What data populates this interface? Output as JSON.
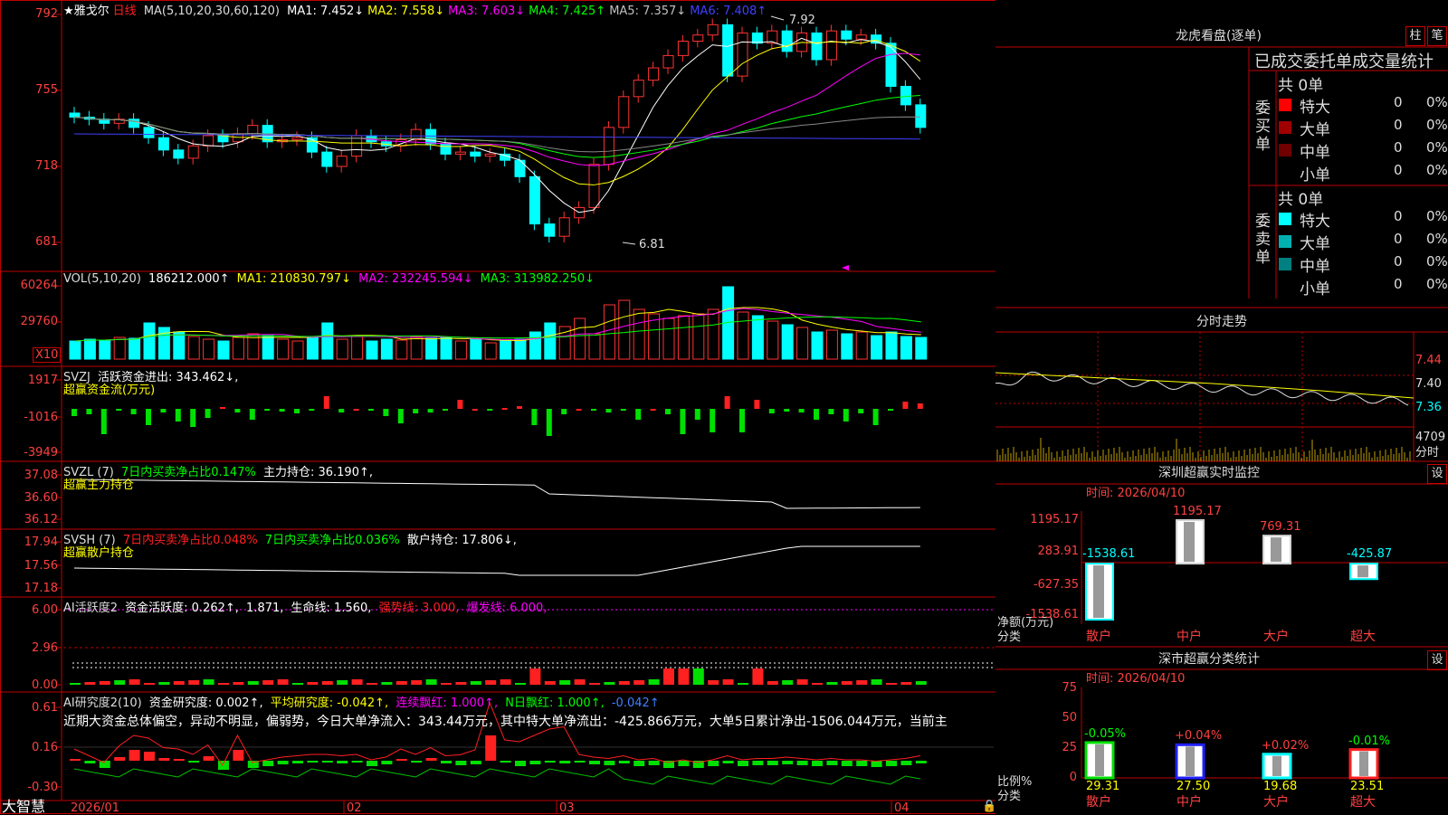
{
  "main": {
    "title": "★雅戈尔",
    "period": "日线",
    "ma_label": "MA(5,10,20,30,60,120)",
    "ma_values": [
      {
        "name": "MA1:",
        "value": "7.452↓",
        "color": "#ffffff"
      },
      {
        "name": "MA2:",
        "value": "7.558↓",
        "color": "#ffff00"
      },
      {
        "name": "MA3:",
        "value": "7.603↓",
        "color": "#ff00ff"
      },
      {
        "name": "MA4:",
        "value": "7.425↑",
        "color": "#00ff00"
      },
      {
        "name": "MA5:",
        "value": "7.357↓",
        "color": "#c0c0c0"
      },
      {
        "name": "MA6:",
        "value": "7.408↑",
        "color": "#4040ff"
      }
    ],
    "y_ticks": [
      "792",
      "755",
      "718",
      "681"
    ],
    "high_mark": "7.92",
    "low_mark": "6.81"
  },
  "vol": {
    "header": "VOL(5,10,20)",
    "value": "186212.000↑",
    "ma1": "MA1: 210830.797↓",
    "ma2": "MA2: 232245.594↓",
    "ma3": "MA3: 313982.250↓",
    "y_ticks": [
      "60264",
      "29760"
    ],
    "unit": "X10"
  },
  "svzj": {
    "header": "SVZJ",
    "line1": "活跃资金进出: 343.462↓,",
    "line2": "超赢资金流(万元)",
    "y_ticks": [
      "1917",
      "-1016",
      "-3949"
    ]
  },
  "svzl": {
    "header": "SVZL (7)",
    "part1": "7日内买卖净占比0.147%",
    "part2": "主力持仓: 36.190↑,",
    "line2": "超赢主力持仓",
    "y_ticks": [
      "37.08",
      "36.60",
      "36.12"
    ]
  },
  "svsh": {
    "header": "SVSH (7)",
    "part1": "7日内买卖净占比0.048%",
    "part2": "7日内买卖净占比0.036%",
    "part3": "散户持仓: 17.806↓,",
    "line2": "超赢散户持仓",
    "y_ticks": [
      "17.94",
      "17.56",
      "17.18"
    ]
  },
  "ai1": {
    "header": "AI活跃度2",
    "part1": "资金活跃度: 0.262↑,",
    "part2": "1.871,",
    "part3": "生命线: 1.560,",
    "part4": "强势线: 3.000,",
    "part5": "爆发线: 6.000,",
    "y_ticks": [
      "6.00",
      "2.96",
      "0.00"
    ]
  },
  "ai2": {
    "header": "AI研究度2(10)",
    "part1": "资金研究度: 0.002↑,",
    "part2": "平均研究度: -0.042↑,",
    "part3": "连续飘红: 1.000↑,",
    "part4": "N日飘红: 1.000↑,",
    "part5": "-0.042↑",
    "text": "近期大资金总体偏空，异动不明显，偏弱势，今日大单净流入：343.44万元，其中特大单净流出：-425.866万元，大单5日累计净出-1506.044万元，当前主",
    "y_ticks": [
      "0.61",
      "0.16",
      "-0.30"
    ]
  },
  "xaxis": {
    "labels": [
      "2026/01",
      "02",
      "03",
      "04"
    ],
    "brand": "大智慧"
  },
  "lhb": {
    "title": "龙虎看盘(逐单)",
    "btn1": "柱",
    "btn2": "笔",
    "subtitle": "已成交委托单成交量统计",
    "buy_label": "委买单",
    "sell_label": "委卖单",
    "buy_total": "共 0单",
    "sell_total": "共 0单",
    "buy_rows": [
      {
        "name": "特大",
        "val": "0",
        "pct": "0%",
        "color": "#ff0000"
      },
      {
        "name": "大单",
        "val": "0",
        "pct": "0%",
        "color": "#a00000"
      },
      {
        "name": "中单",
        "val": "0",
        "pct": "0%",
        "color": "#700000"
      },
      {
        "name": "小单",
        "val": "0",
        "pct": "0%",
        "color": "#000000"
      }
    ],
    "sell_rows": [
      {
        "name": "特大",
        "val": "0",
        "pct": "0%",
        "color": "#00ffff"
      },
      {
        "name": "大单",
        "val": "0",
        "pct": "0%",
        "color": "#00b0b0"
      },
      {
        "name": "中单",
        "val": "0",
        "pct": "0%",
        "color": "#008080"
      },
      {
        "name": "小单",
        "val": "0",
        "pct": "0%",
        "color": "#000000"
      }
    ]
  },
  "fenshi": {
    "title": "分时走势",
    "y_ticks": [
      "7.44",
      "7.40",
      "7.36"
    ],
    "vol_tick": "4709",
    "vol_label": "分时"
  },
  "sz_monitor": {
    "title": "深圳超赢实时监控",
    "btn": "设",
    "time": "时间: 2026/04/10",
    "y_ticks": [
      "1195.17",
      "283.91",
      "-627.35",
      "-1538.61"
    ],
    "y_label": "净额(万元)",
    "x_label": "分类",
    "categories": [
      "散户",
      "中户",
      "大户",
      "超大"
    ],
    "values": [
      -1538.61,
      1195.17,
      769.31,
      -425.87
    ],
    "value_labels": [
      "-1538.61",
      "1195.17",
      "769.31",
      "-425.87"
    ]
  },
  "sz_stats": {
    "title": "深市超赢分类统计",
    "btn": "设",
    "time": "时间: 2026/04/10",
    "y_ticks": [
      "75",
      "50",
      "25",
      "0"
    ],
    "y_label": "比例%",
    "x_label": "分类",
    "categories": [
      "散户",
      "中户",
      "大户",
      "超大"
    ],
    "values": [
      29.31,
      27.5,
      19.68,
      23.51
    ],
    "changes": [
      "-0.05%",
      "+0.04%",
      "+0.02%",
      "-0.01%"
    ],
    "value_labels": [
      "29.31",
      "27.50",
      "19.68",
      "23.51"
    ]
  },
  "chart_data": [
    {
      "type": "bar",
      "title": "深圳超赢实时监控",
      "categories": [
        "散户",
        "中户",
        "大户",
        "超大"
      ],
      "values": [
        -1538.61,
        1195.17,
        769.31,
        -425.87
      ],
      "ylabel": "净额(万元)",
      "xlabel": "分类",
      "ylim": [
        -1538.61,
        1195.17
      ]
    },
    {
      "type": "bar",
      "title": "深市超赢分类统计",
      "categories": [
        "散户",
        "中户",
        "大户",
        "超大"
      ],
      "values": [
        29.31,
        27.5,
        19.68,
        23.51
      ],
      "ylabel": "比例%",
      "xlabel": "分类",
      "ylim": [
        0,
        75
      ]
    }
  ]
}
